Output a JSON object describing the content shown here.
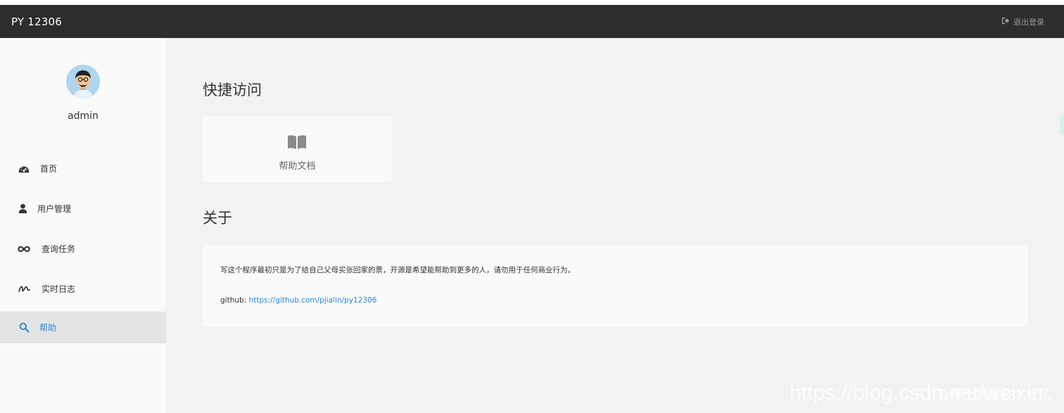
{
  "header": {
    "brand": "PY 12306",
    "logout_label": "退出登录"
  },
  "sidebar": {
    "username": "admin",
    "items": [
      {
        "label": "首页",
        "icon": "dashboard-icon"
      },
      {
        "label": "用户管理",
        "icon": "user-icon"
      },
      {
        "label": "查询任务",
        "icon": "infinity-icon"
      },
      {
        "label": "实时日志",
        "icon": "signature-icon"
      },
      {
        "label": "帮助",
        "icon": "search-icon",
        "active": true
      }
    ]
  },
  "main": {
    "quick_access_title": "快捷访问",
    "quick_card": {
      "label": "帮助文档",
      "icon": "book-icon"
    },
    "about_title": "关于",
    "about_text": "写这个程序最初只是为了给自己父母买张回家的票，开源是希望能帮助到更多的人，请勿用于任何商业行为。",
    "github_prefix": "github:",
    "github_url": "https://github.com/pjialin/py12306"
  },
  "watermark": {
    "url_text": "https://blog.csdn.net/weixin",
    "site_text": "@稀土掘金技术社区"
  },
  "colors": {
    "header_bg": "#2d2d2d",
    "accent": "#2f8ad8",
    "sidebar_bg": "#fafafa",
    "main_bg": "#f2f2f2"
  }
}
